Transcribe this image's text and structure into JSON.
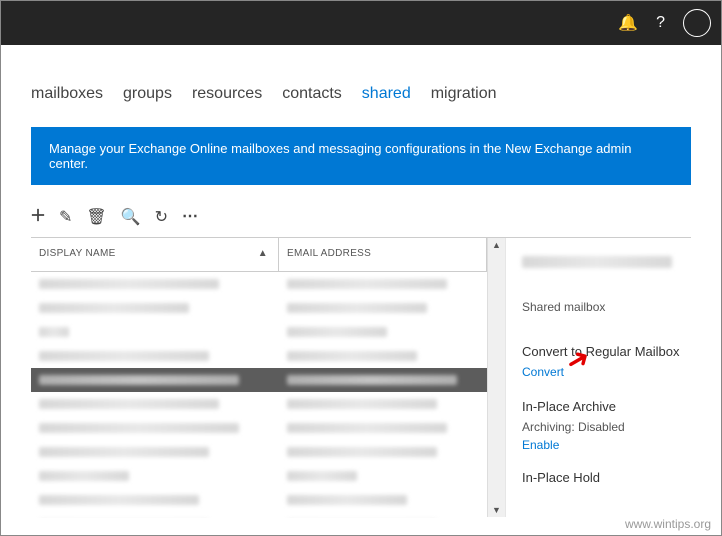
{
  "tabs": {
    "mailboxes": "mailboxes",
    "groups": "groups",
    "resources": "resources",
    "contacts": "contacts",
    "shared": "shared",
    "migration": "migration"
  },
  "banner": {
    "text": "Manage your Exchange Online mailboxes and messaging configurations in the New Exchange admin center."
  },
  "columns": {
    "display_name": "DISPLAY NAME",
    "email_address": "EMAIL ADDRESS"
  },
  "details": {
    "type": "Shared mailbox",
    "convert_head": "Convert to Regular Mailbox",
    "convert_link": "Convert",
    "archive_head": "In-Place Archive",
    "archive_status_label": "Archiving:",
    "archive_status_value": "Disabled",
    "archive_enable": "Enable",
    "hold_head": "In-Place Hold"
  },
  "watermark": "www.wintips.org"
}
